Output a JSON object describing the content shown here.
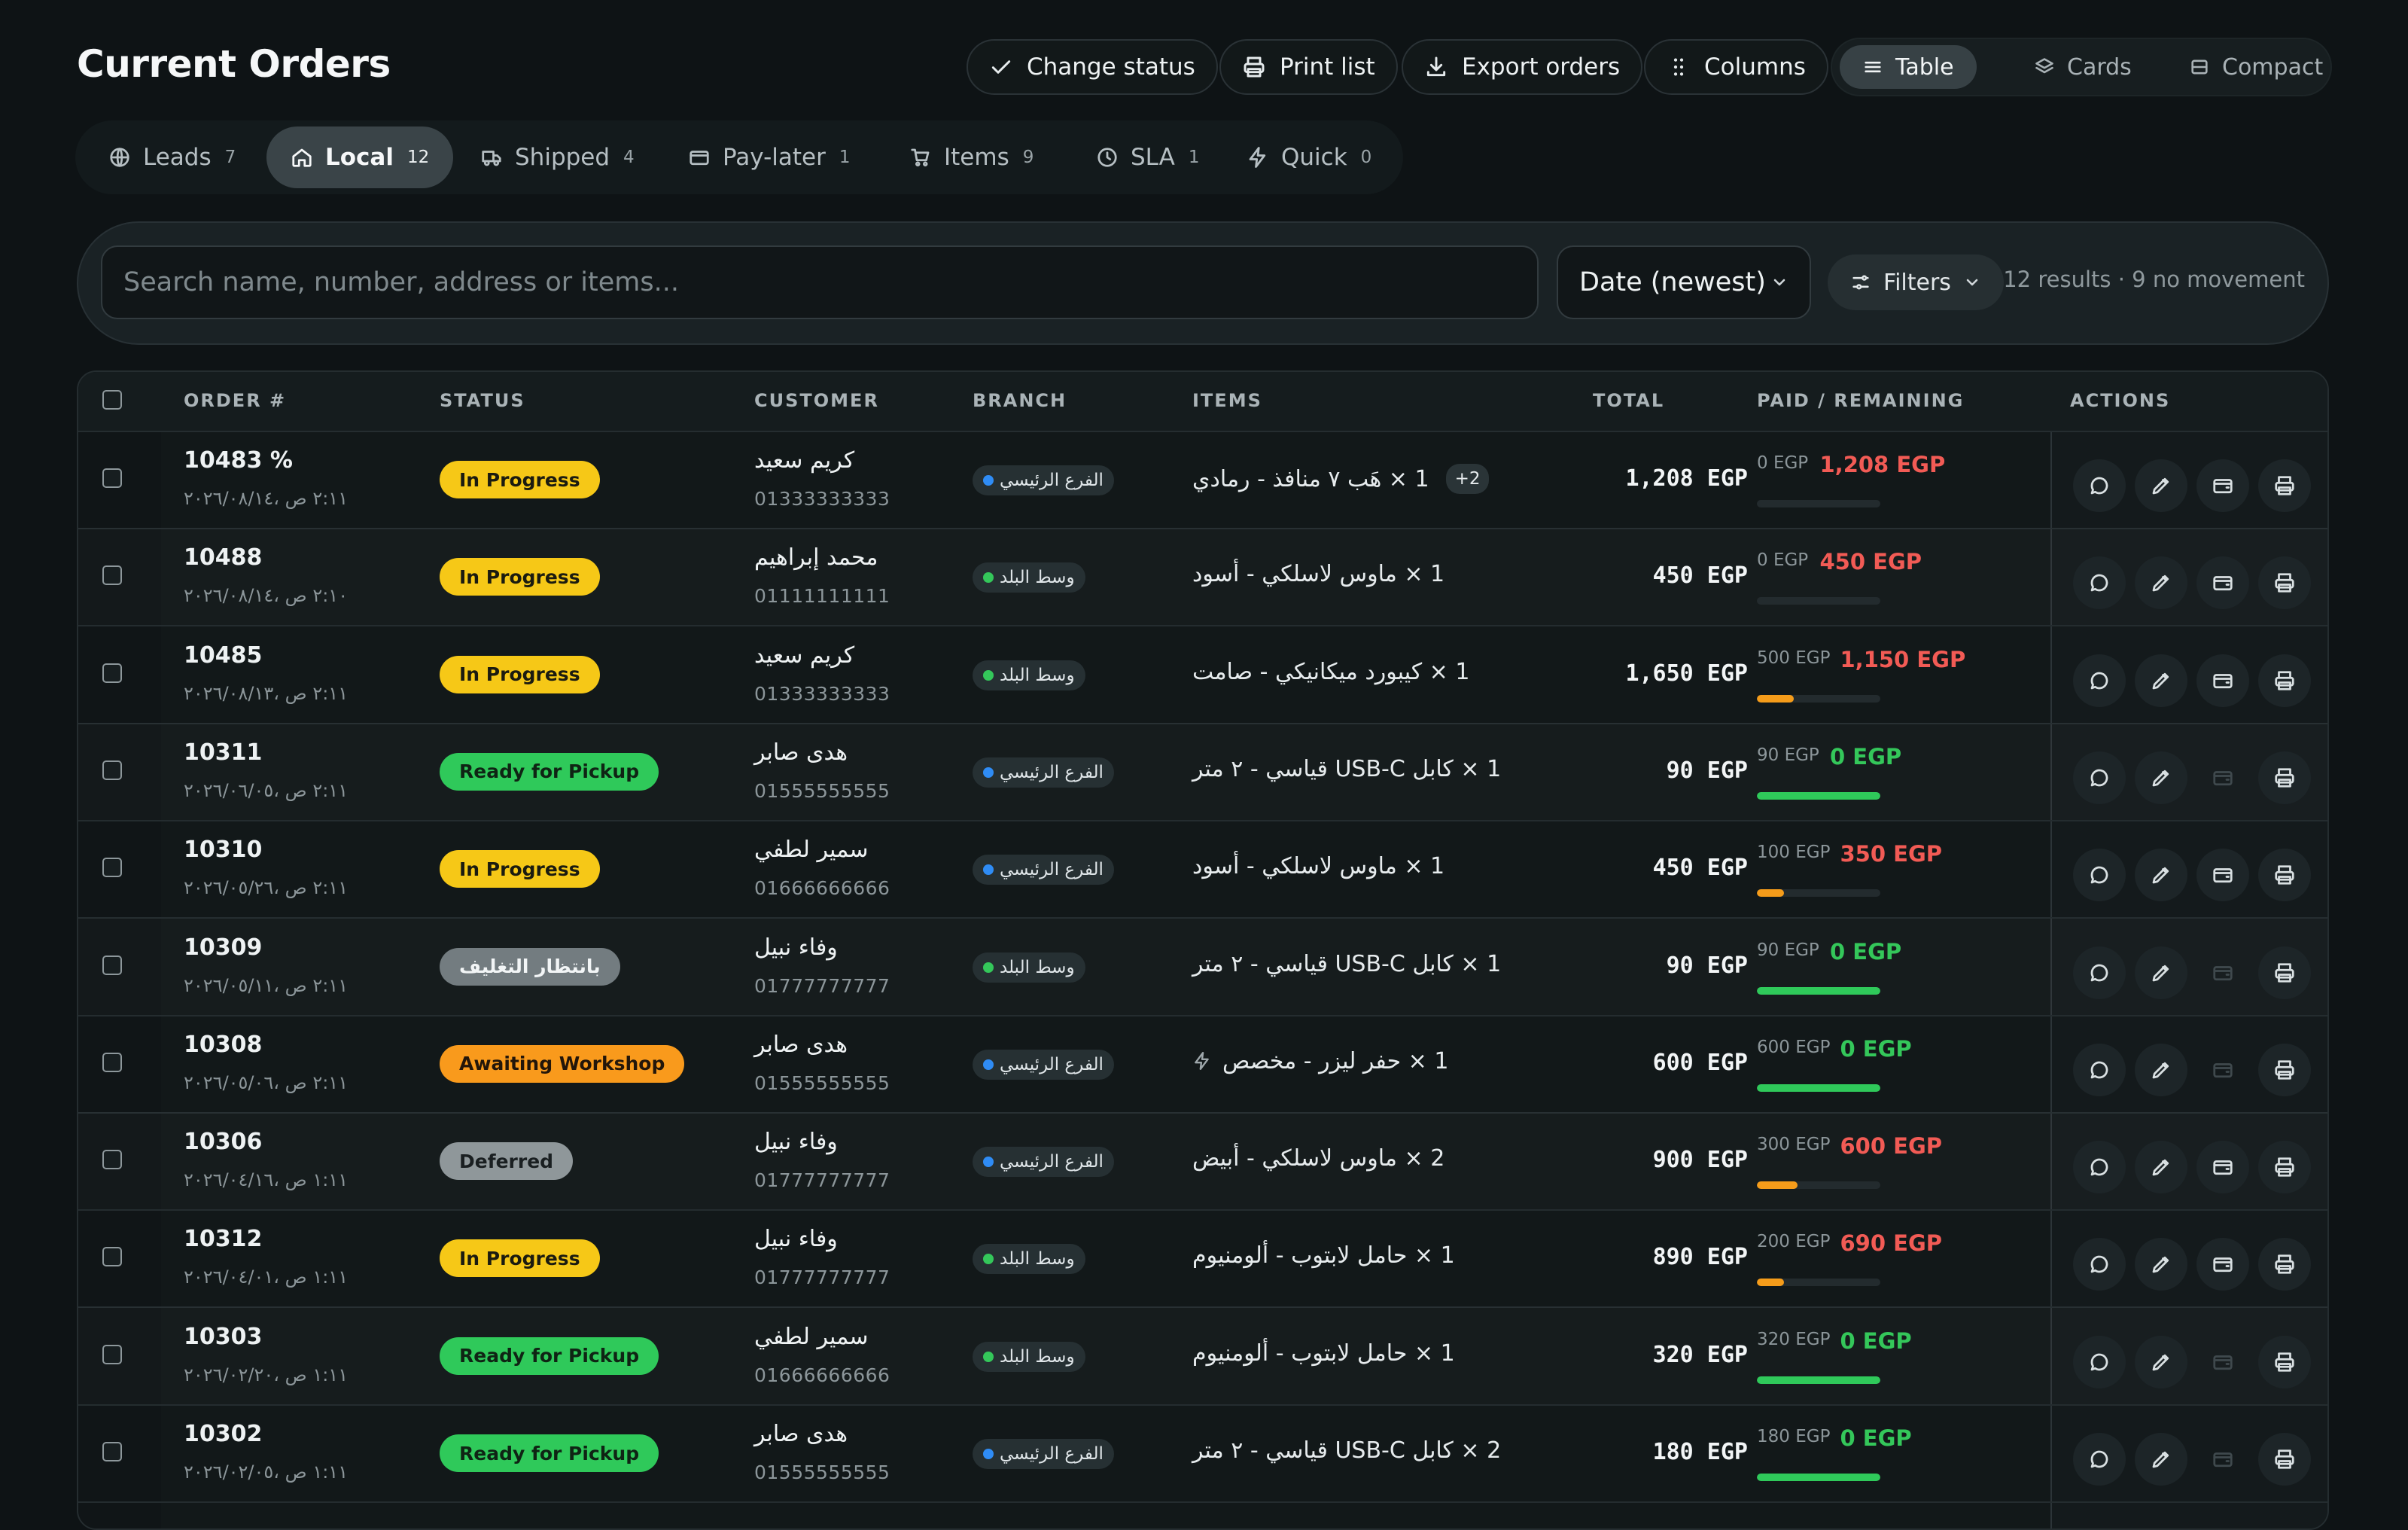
{
  "page_title": "Current Orders",
  "toolbar": {
    "change_status": "Change status",
    "print_list": "Print list",
    "export_orders": "Export orders",
    "columns": "Columns",
    "views": [
      {
        "label": "Table",
        "icon": "table-icon",
        "active": true
      },
      {
        "label": "Cards",
        "icon": "cards-icon",
        "active": false
      },
      {
        "label": "Compact",
        "icon": "compact-icon",
        "active": false
      }
    ]
  },
  "tabs": [
    {
      "label": "Leads",
      "count": "7",
      "icon": "globe-icon",
      "active": false
    },
    {
      "label": "Local",
      "count": "12",
      "icon": "home-icon",
      "active": true
    },
    {
      "label": "Shipped",
      "count": "4",
      "icon": "truck-icon",
      "active": false
    },
    {
      "label": "Pay-later",
      "count": "1",
      "icon": "wallet-icon",
      "active": false
    },
    {
      "label": "Items",
      "count": "9",
      "icon": "cart-icon",
      "active": false
    },
    {
      "label": "SLA",
      "count": "1",
      "icon": "clock-icon",
      "active": false
    },
    {
      "label": "Quick",
      "count": "0",
      "icon": "bolt-icon",
      "active": false
    }
  ],
  "search": {
    "placeholder": "Search name, number, address or items...",
    "value": ""
  },
  "sort": {
    "selected": "Date (newest)"
  },
  "filters_label": "Filters",
  "results_text": "12 results · 9 no movement",
  "table": {
    "columns": [
      "ORDER #",
      "STATUS",
      "CUSTOMER",
      "BRANCH",
      "ITEMS",
      "TOTAL",
      "PAID / REMAINING",
      "ACTIONS"
    ],
    "rows": [
      {
        "order": "10483 %",
        "date": "٢:١١ ص ،٢٠٢٦/٠٨/١٤",
        "status": "In Progress",
        "status_bg": "#f6c817",
        "status_fg": "#1b1b10",
        "customer": "كريم سعيد",
        "phone": "01333333333",
        "branch": "الفرع الرئيسي",
        "branch_dot": "#2f8cf5",
        "item": "1 × هَب ٧ منافذ - رمادي",
        "more": "+2",
        "bolt": false,
        "total": "1,208 EGP",
        "paid": "0 EGP",
        "remaining": "1,208 EGP",
        "remaining_color": "#f25b55",
        "progress": 0,
        "progress_color": "#f59c1a",
        "wallet_enabled": true
      },
      {
        "order": "10488",
        "date": "٢:١٠ ص ،٢٠٢٦/٠٨/١٤",
        "status": "In Progress",
        "status_bg": "#f6c817",
        "status_fg": "#1b1b10",
        "customer": "محمد إبراهيم",
        "phone": "01111111111",
        "branch": "وسط البلد",
        "branch_dot": "#34c75a",
        "item": "1 × ماوس لاسلكي - أسود",
        "more": "",
        "bolt": false,
        "total": "450 EGP",
        "paid": "0 EGP",
        "remaining": "450 EGP",
        "remaining_color": "#f25b55",
        "progress": 0,
        "progress_color": "#f59c1a",
        "wallet_enabled": true
      },
      {
        "order": "10485",
        "date": "٢:١١ ص ،٢٠٢٦/٠٨/١٣",
        "status": "In Progress",
        "status_bg": "#f6c817",
        "status_fg": "#1b1b10",
        "customer": "كريم سعيد",
        "phone": "01333333333",
        "branch": "وسط البلد",
        "branch_dot": "#34c75a",
        "item": "1 × كيبورد ميكانيكي - صامت",
        "more": "",
        "bolt": false,
        "total": "1,650 EGP",
        "paid": "500 EGP",
        "remaining": "1,150 EGP",
        "remaining_color": "#f25b55",
        "progress": 0.3,
        "progress_color": "#f59c1a",
        "wallet_enabled": true
      },
      {
        "order": "10311",
        "date": "٢:١١ ص ،٢٠٢٦/٠٦/٠٥",
        "status": "Ready for Pickup",
        "status_bg": "#2fc95a",
        "status_fg": "#0f2414",
        "customer": "هدى صابر",
        "phone": "01555555555",
        "branch": "الفرع الرئيسي",
        "branch_dot": "#2f8cf5",
        "item": "1 × كابل USB-C قياسي - ٢ متر",
        "more": "",
        "bolt": false,
        "total": "90 EGP",
        "paid": "90 EGP",
        "remaining": "0 EGP",
        "remaining_color": "#34c75a",
        "progress": 1,
        "progress_color": "#2fc95a",
        "wallet_enabled": false
      },
      {
        "order": "10310",
        "date": "٢:١١ ص ،٢٠٢٦/٠٥/٢٦",
        "status": "In Progress",
        "status_bg": "#f6c817",
        "status_fg": "#1b1b10",
        "customer": "سمير لطفي",
        "phone": "01666666666",
        "branch": "الفرع الرئيسي",
        "branch_dot": "#2f8cf5",
        "item": "1 × ماوس لاسلكي - أسود",
        "more": "",
        "bolt": false,
        "total": "450 EGP",
        "paid": "100 EGP",
        "remaining": "350 EGP",
        "remaining_color": "#f25b55",
        "progress": 0.22,
        "progress_color": "#f59c1a",
        "wallet_enabled": true
      },
      {
        "order": "10309",
        "date": "٢:١١ ص ،٢٠٢٦/٠٥/١١",
        "status": "بانتظار التغليف",
        "status_bg": "#737c80",
        "status_fg": "#f2f5f6",
        "customer": "وفاء نبيل",
        "phone": "01777777777",
        "branch": "وسط البلد",
        "branch_dot": "#34c75a",
        "item": "1 × كابل USB-C قياسي - ٢ متر",
        "more": "",
        "bolt": false,
        "total": "90 EGP",
        "paid": "90 EGP",
        "remaining": "0 EGP",
        "remaining_color": "#34c75a",
        "progress": 1,
        "progress_color": "#2fc95a",
        "wallet_enabled": false
      },
      {
        "order": "10308",
        "date": "٢:١١ ص ،٢٠٢٦/٠٥/٠٦",
        "status": "Awaiting Workshop",
        "status_bg": "#f99a1c",
        "status_fg": "#23160a",
        "customer": "هدى صابر",
        "phone": "01555555555",
        "branch": "الفرع الرئيسي",
        "branch_dot": "#2f8cf5",
        "item": "1 × حفر ليزر - مخصص",
        "more": "",
        "bolt": true,
        "total": "600 EGP",
        "paid": "600 EGP",
        "remaining": "0 EGP",
        "remaining_color": "#34c75a",
        "progress": 1,
        "progress_color": "#2fc95a",
        "wallet_enabled": false
      },
      {
        "order": "10306",
        "date": "١:١١ ص ،٢٠٢٦/٠٤/١٦",
        "status": "Deferred",
        "status_bg": "#8f979a",
        "status_fg": "#1a1f21",
        "customer": "وفاء نبيل",
        "phone": "01777777777",
        "branch": "الفرع الرئيسي",
        "branch_dot": "#2f8cf5",
        "item": "2 × ماوس لاسلكي - أبيض",
        "more": "",
        "bolt": false,
        "total": "900 EGP",
        "paid": "300 EGP",
        "remaining": "600 EGP",
        "remaining_color": "#f25b55",
        "progress": 0.33,
        "progress_color": "#f59c1a",
        "wallet_enabled": true
      },
      {
        "order": "10312",
        "date": "١:١١ ص ،٢٠٢٦/٠٤/٠١",
        "status": "In Progress",
        "status_bg": "#f6c817",
        "status_fg": "#1b1b10",
        "customer": "وفاء نبيل",
        "phone": "01777777777",
        "branch": "وسط البلد",
        "branch_dot": "#34c75a",
        "item": "1 × حامل لابتوب - ألومنيوم",
        "more": "",
        "bolt": false,
        "total": "890 EGP",
        "paid": "200 EGP",
        "remaining": "690 EGP",
        "remaining_color": "#f25b55",
        "progress": 0.22,
        "progress_color": "#f59c1a",
        "wallet_enabled": true
      },
      {
        "order": "10303",
        "date": "١:١١ ص ،٢٠٢٦/٠٢/٢٠",
        "status": "Ready for Pickup",
        "status_bg": "#2fc95a",
        "status_fg": "#0f2414",
        "customer": "سمير لطفي",
        "phone": "01666666666",
        "branch": "وسط البلد",
        "branch_dot": "#34c75a",
        "item": "1 × حامل لابتوب - ألومنيوم",
        "more": "",
        "bolt": false,
        "total": "320 EGP",
        "paid": "320 EGP",
        "remaining": "0 EGP",
        "remaining_color": "#34c75a",
        "progress": 1,
        "progress_color": "#2fc95a",
        "wallet_enabled": false
      },
      {
        "order": "10302",
        "date": "١:١١ ص ،٢٠٢٦/٠٢/٠٥",
        "status": "Ready for Pickup",
        "status_bg": "#2fc95a",
        "status_fg": "#0f2414",
        "customer": "هدى صابر",
        "phone": "01555555555",
        "branch": "الفرع الرئيسي",
        "branch_dot": "#2f8cf5",
        "item": "2 × كابل USB-C قياسي - ٢ متر",
        "more": "",
        "bolt": false,
        "total": "180 EGP",
        "paid": "180 EGP",
        "remaining": "0 EGP",
        "remaining_color": "#34c75a",
        "progress": 1,
        "progress_color": "#2fc95a",
        "wallet_enabled": false
      }
    ]
  }
}
